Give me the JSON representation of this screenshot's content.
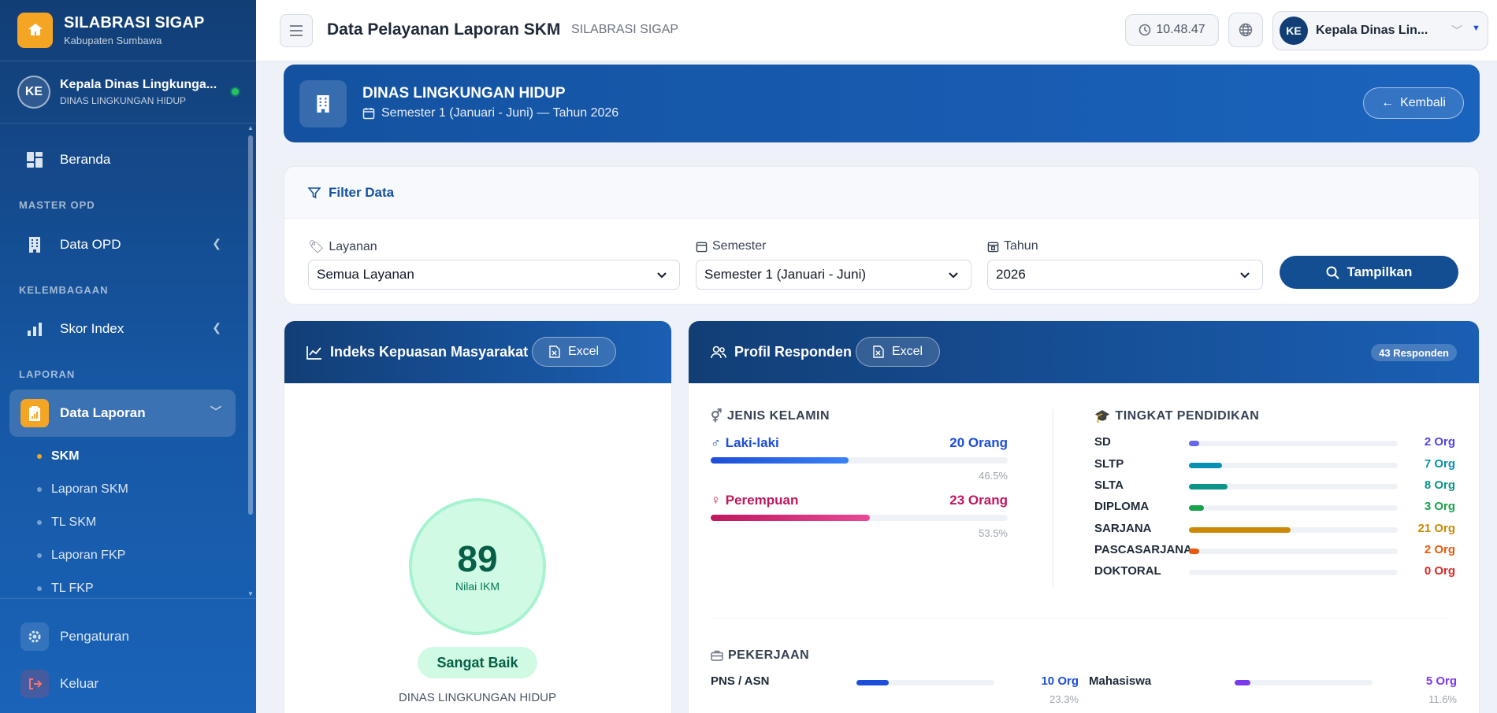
{
  "brand": {
    "title": "SILABRASI SIGAP",
    "subtitle": "Kabupaten Sumbawa",
    "accent": "#f5a524"
  },
  "user": {
    "initials": "KE",
    "name": "Kepala Dinas Lingkunga...",
    "org": "DINAS LINGKUNGAN HIDUP",
    "status": "online"
  },
  "nav": {
    "home": "Beranda",
    "section_master": "MASTER OPD",
    "data_opd": "Data OPD",
    "section_lembaga": "KELEMBAGAAN",
    "skor_index": "Skor Index",
    "section_laporan": "LAPORAN",
    "data_laporan": "Data Laporan",
    "sub_items": [
      "SKM",
      "Laporan SKM",
      "TL SKM",
      "Laporan FKP",
      "TL FKP"
    ],
    "settings": "Pengaturan",
    "logout": "Keluar"
  },
  "header": {
    "title": "Data Pelayanan Laporan SKM",
    "breadcrumb": "SILABRASI SIGAP",
    "time": "10.48.47",
    "user_initials": "KE",
    "user_name": "Kepala Dinas Lin..."
  },
  "banner": {
    "title": "DINAS LINGKUNGAN HIDUP",
    "subtitle": "Semester 1 (Januari - Juni) — Tahun 2026",
    "back_label": "Kembali"
  },
  "filter": {
    "title": "Filter Data",
    "layanan_label": "Layanan",
    "layanan_value": "Semua Layanan",
    "semester_label": "Semester",
    "semester_value": "Semester 1 (Januari - Juni)",
    "tahun_label": "Tahun",
    "tahun_value": "2026",
    "submit_label": "Tampilkan"
  },
  "ikm": {
    "title": "Indeks Kepuasan Masyarakat",
    "excel_label": "Excel",
    "value": "89",
    "value_label": "Nilai IKM",
    "category": "Sangat Baik",
    "org": "DINAS LINGKUNGAN HIDUP"
  },
  "profil": {
    "title": "Profil Responden",
    "excel_label": "Excel",
    "badge": "43 Responden",
    "gender_title": "JENIS KELAMIN",
    "gender": [
      {
        "label": "Laki-laki",
        "value": "20 Orang",
        "pct": "46.5%",
        "fraction": 0.465,
        "color": "#1d4ed8"
      },
      {
        "label": "Perempuan",
        "value": "23 Orang",
        "pct": "53.5%",
        "fraction": 0.535,
        "color": "#be185d"
      }
    ],
    "edu_title": "TINGKAT PENDIDIKAN",
    "education": [
      {
        "name": "SD",
        "value": "2 Org",
        "count": 2,
        "color": "#6366f1"
      },
      {
        "name": "SLTP",
        "value": "7 Org",
        "count": 7,
        "color": "#0891b2"
      },
      {
        "name": "SLTA",
        "value": "8 Org",
        "count": 8,
        "color": "#0d9488"
      },
      {
        "name": "DIPLOMA",
        "value": "3 Org",
        "count": 3,
        "color": "#16a34a"
      },
      {
        "name": "SARJANA",
        "value": "21 Org",
        "count": 21,
        "color": "#ca8a04"
      },
      {
        "name": "PASCASARJANA",
        "value": "2 Org",
        "count": 2,
        "color": "#ea580c"
      },
      {
        "name": "DOKTORAL",
        "value": "0 Org",
        "count": 0,
        "color": "#dc2626"
      }
    ],
    "job_title": "PEKERJAAN",
    "jobs": [
      {
        "name": "PNS / ASN",
        "value": "10 Org",
        "pct": "23.3%",
        "fraction": 0.233,
        "color": "#1d4ed8"
      },
      {
        "name": "Mahasiswa",
        "value": "5 Org",
        "pct": "11.6%",
        "fraction": 0.116,
        "color": "#7c3aed"
      }
    ]
  }
}
